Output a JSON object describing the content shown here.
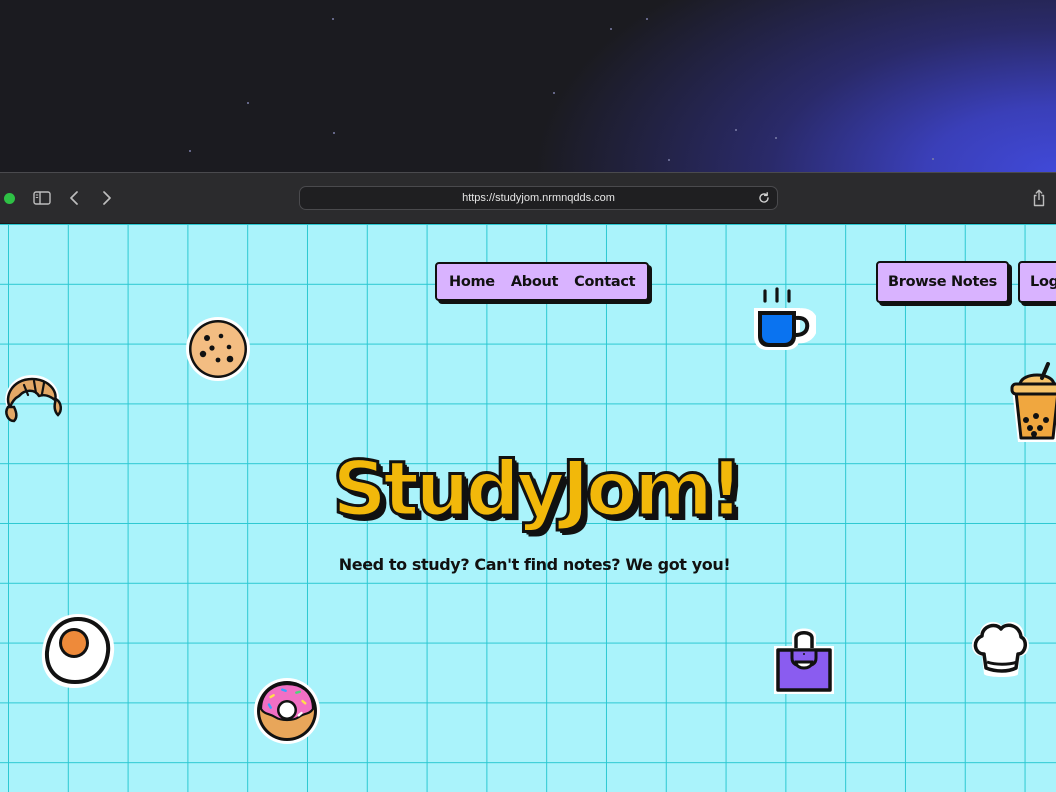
{
  "browser": {
    "url": "https://studyjom.nrmnqdds.com",
    "icons": {
      "sidebar": "sidebar-icon",
      "back": "chevron-left-icon",
      "forward": "chevron-right-icon",
      "reload": "reload-icon",
      "share": "share-icon"
    }
  },
  "nav": {
    "items": [
      {
        "label": "Home"
      },
      {
        "label": "About"
      },
      {
        "label": "Contact"
      }
    ]
  },
  "actions": {
    "browse_label": "Browse Notes",
    "login_label": "Log"
  },
  "hero": {
    "title": "StudyJom!",
    "subtitle": "Need to study? Can't find notes? We got you!"
  },
  "stickers": [
    "cookie-icon",
    "croissant-icon",
    "coffee-mug-icon",
    "bubble-tea-icon",
    "fried-egg-icon",
    "donut-icon",
    "apron-icon",
    "chef-hat-icon"
  ],
  "colors": {
    "page_bg": "#aaf3fb",
    "grid": "#2cc8d2",
    "button_bg": "#d9b3ff",
    "title": "#f2b80a",
    "outline": "#111111"
  }
}
